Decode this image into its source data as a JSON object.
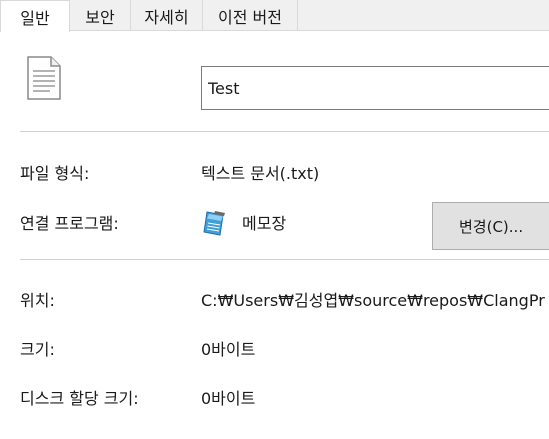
{
  "tabs": [
    {
      "label": "일반",
      "active": true
    },
    {
      "label": "보안",
      "active": false
    },
    {
      "label": "자세히",
      "active": false
    },
    {
      "label": "이전 버전",
      "active": false
    }
  ],
  "file": {
    "icon": "text-document-icon",
    "name": "Test"
  },
  "properties": {
    "type_label": "파일 형식:",
    "type_value": "텍스트 문서(.txt)",
    "opens_with_label": "연결 프로그램:",
    "opens_with_icon": "notepad-icon",
    "opens_with_value": "메모장",
    "change_button": "변경(C)...",
    "location_label": "위치:",
    "location_value": "C:₩Users₩김성엽₩source₩repos₩ClangPr",
    "size_label": "크기:",
    "size_value": "0바이트",
    "size_on_disk_label": "디스크 할당 크기:",
    "size_on_disk_value": "0바이트"
  }
}
